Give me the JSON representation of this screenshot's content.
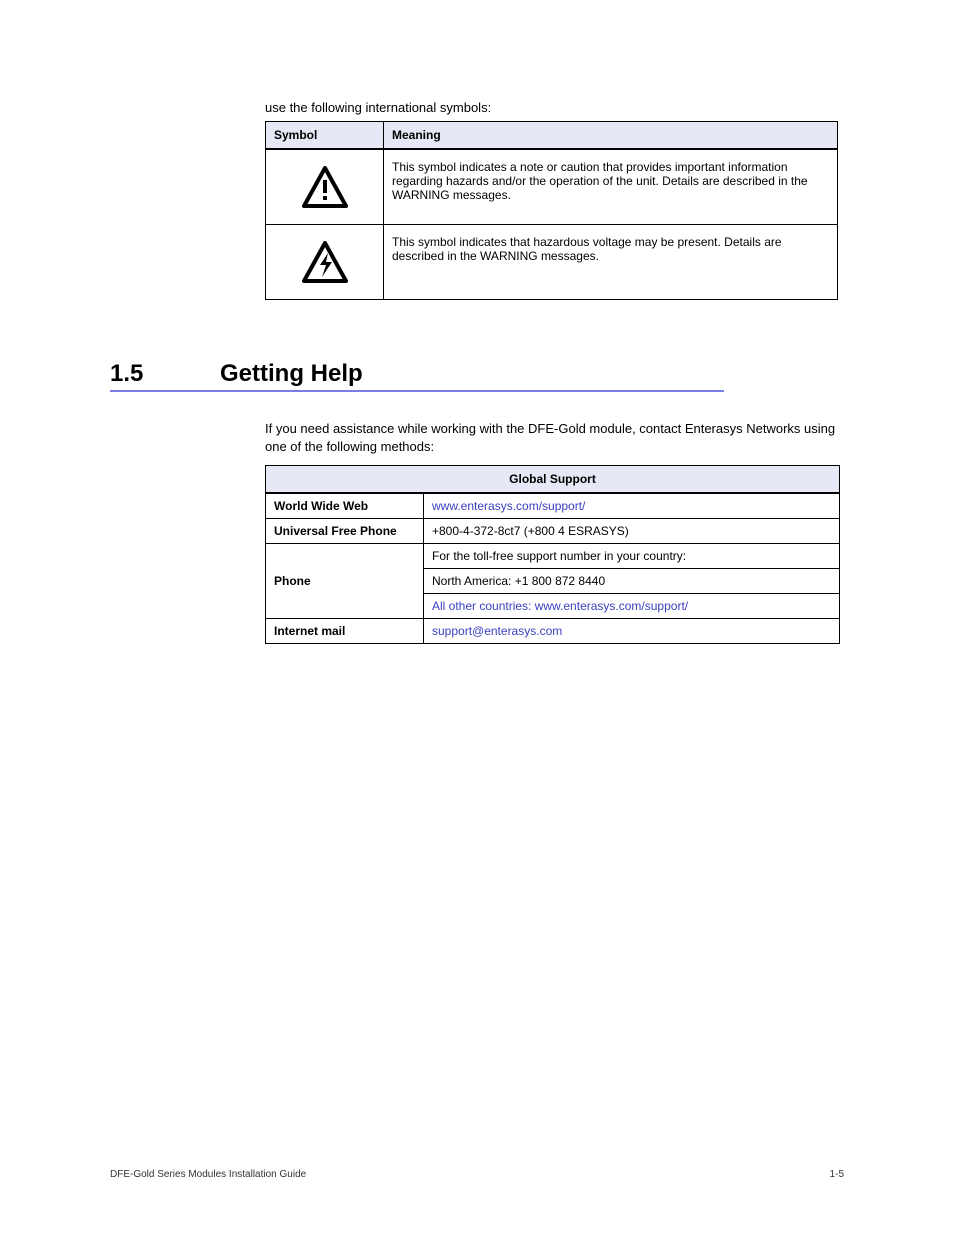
{
  "intro": "use the following international symbols:",
  "symTable": {
    "headers": [
      "Symbol",
      "Meaning"
    ],
    "rows": [
      {
        "meaning": "This symbol indicates a note or caution that provides important information regarding hazards and/or the operation of the unit. Details are described in the WARNING messages."
      },
      {
        "meaning": "This symbol indicates that hazardous voltage may be present. Details are described in the WARNING messages."
      }
    ]
  },
  "section": {
    "num": "1.5",
    "title": "Getting Help",
    "body": "If you need assistance while working with the DFE-Gold module, contact Enterasys Networks using one of the following methods:"
  },
  "contactTable": {
    "title": "Global Support",
    "rows": [
      {
        "label": "World Wide Web",
        "value": "www.enterasys.com/support/",
        "link": true
      },
      {
        "label": "Universal Free Phone",
        "value": "+800-4-372-8ct7 (+800 4 ESRASYS)"
      },
      {
        "label": "Phone",
        "value": "For the toll-free support number in your country:",
        "sub": [
          "North America: +1 800 872 8440",
          {
            "text": "All other countries: www.enterasys.com/support/",
            "link": true
          }
        ]
      },
      {
        "label": "Internet mail",
        "value": "support@enterasys.com",
        "link": true
      }
    ]
  },
  "footer": {
    "left": "DFE-Gold Series Modules Installation Guide",
    "right": "1-5"
  }
}
